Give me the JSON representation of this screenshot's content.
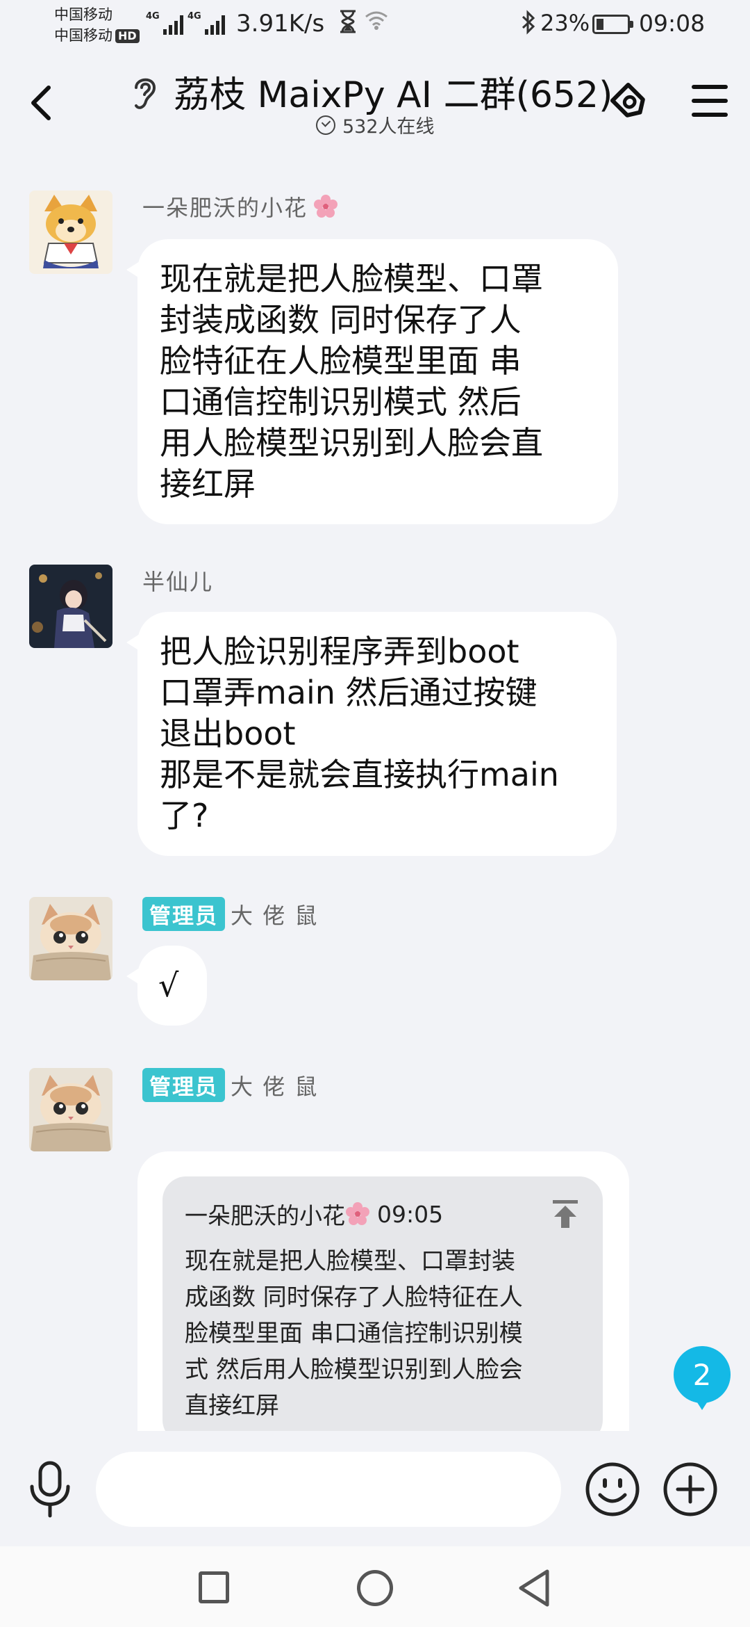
{
  "status_bar": {
    "carrier1": "中国移动",
    "carrier2": "中国移动",
    "hd": "HD",
    "net1": "4G",
    "net2": "4G",
    "net_speed": "3.91K/s",
    "battery_pct": "23%",
    "battery_level": 0.23,
    "time": "09:08"
  },
  "header": {
    "title": "荔枝 MaixPy AI 二群(652)",
    "online": "532人在线"
  },
  "messages": [
    {
      "sender": "一朵肥沃的小花",
      "is_admin": false,
      "text": "现在就是把人脸模型、口罩\n封装成函数  同时保存了人\n脸特征在人脸模型里面   串\n口通信控制识别模式   然后\n用人脸模型识别到人脸会直\n接红屏"
    },
    {
      "sender": "半仙儿",
      "is_admin": false,
      "text": " 把人脸识别程序弄到boot\n口罩弄main 然后通过按键\n退出boot\n那是不是就会直接执行main\n了?"
    },
    {
      "sender": "大 佬 鼠",
      "is_admin": true,
      "admin_label": "管理员",
      "text": "√"
    },
    {
      "sender": "大 佬 鼠",
      "is_admin": true,
      "admin_label": "管理员",
      "quote": {
        "author": "一朵肥沃的小花",
        "time": "09:05",
        "text": "现在就是把人脸模型、口罩封装\n成函数  同时保存了人脸特征在人\n脸模型里面   串口通信控制识别模\n式   然后用人脸模型识别到人脸会\n直接红屏"
      }
    }
  ],
  "unread_count": "2",
  "input": {
    "placeholder": ""
  },
  "colors": {
    "background": "#f2f3f7",
    "admin_badge": "#3bc4cf",
    "unread_badge": "#14b9e6"
  }
}
